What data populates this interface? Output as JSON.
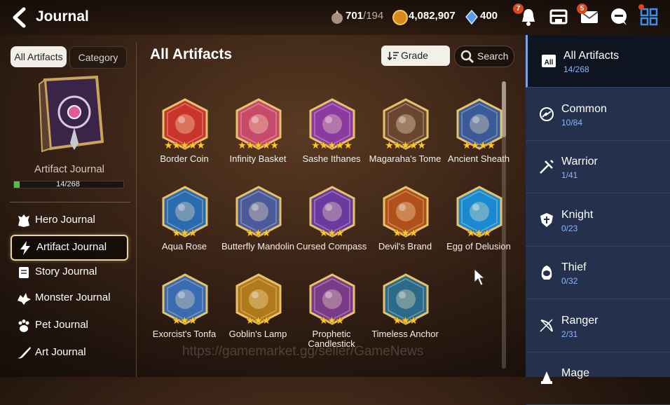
{
  "header": {
    "title": "Journal",
    "stamina": "701",
    "stamina_max": "/194",
    "gold": "4,082,907",
    "crystals": "400",
    "notif_badge": "7",
    "mail_badge": "5"
  },
  "left": {
    "tabs": [
      "All Artifacts",
      "Category"
    ],
    "book_label": "Artifact Journal",
    "book_count": "14/268",
    "book_progress": 0.052,
    "menu": [
      "Hero Journal",
      "Artifact Journal",
      "Story Journal",
      "Monster Journal",
      "Pet Journal",
      "Art Journal"
    ]
  },
  "main": {
    "title": "All Artifacts",
    "grade_label": "Grade",
    "search_label": "Search",
    "artifacts": [
      {
        "name": "Border Coin",
        "stars": 5,
        "color": "#c8352a"
      },
      {
        "name": "Infinity Basket",
        "stars": 5,
        "color": "#c84a6a"
      },
      {
        "name": "Sashe Ithanes",
        "stars": 5,
        "color": "#8a3aa0"
      },
      {
        "name": "Magaraha's Tome",
        "stars": 5,
        "color": "#6a4630"
      },
      {
        "name": "Ancient Sheath",
        "stars": 4,
        "color": "#3a5a9a"
      },
      {
        "name": "Aqua Rose",
        "stars": 3,
        "color": "#2a6ab0"
      },
      {
        "name": "Butterfly Mandolin",
        "stars": 3,
        "color": "#4a5a9a"
      },
      {
        "name": "Cursed Compass",
        "stars": 3,
        "color": "#6a3aa0"
      },
      {
        "name": "Devil's Brand",
        "stars": 3,
        "color": "#b0501a"
      },
      {
        "name": "Egg of Delusion",
        "stars": 3,
        "color": "#1a8ad0"
      },
      {
        "name": "Exorcist's Tonfa",
        "stars": 3,
        "color": "#3a6ab0"
      },
      {
        "name": "Goblin's Lamp",
        "stars": 3,
        "color": "#b07a1a"
      },
      {
        "name": "Prophetic Candlestick",
        "stars": 3,
        "color": "#7a3a8a"
      },
      {
        "name": "Timeless Anchor",
        "stars": 3,
        "color": "#2a6a8a"
      }
    ],
    "watermark": "https://gamemarket.gg/seller/GameNews"
  },
  "right": {
    "items": [
      {
        "icon": "all",
        "label": "All Artifacts",
        "count": "14/268"
      },
      {
        "icon": "common",
        "label": "Common",
        "count": "10/84"
      },
      {
        "icon": "warrior",
        "label": "Warrior",
        "count": "1/41"
      },
      {
        "icon": "knight",
        "label": "Knight",
        "count": "0/23"
      },
      {
        "icon": "thief",
        "label": "Thief",
        "count": "0/32"
      },
      {
        "icon": "ranger",
        "label": "Ranger",
        "count": "2/31"
      },
      {
        "icon": "mage",
        "label": "Mage",
        "count": ""
      }
    ]
  },
  "colors": {
    "accent_gold": "#e8d59a",
    "panel_blue": "#24304c",
    "count_blue": "#8fb6ff",
    "progress_green": "#4ec04e"
  }
}
